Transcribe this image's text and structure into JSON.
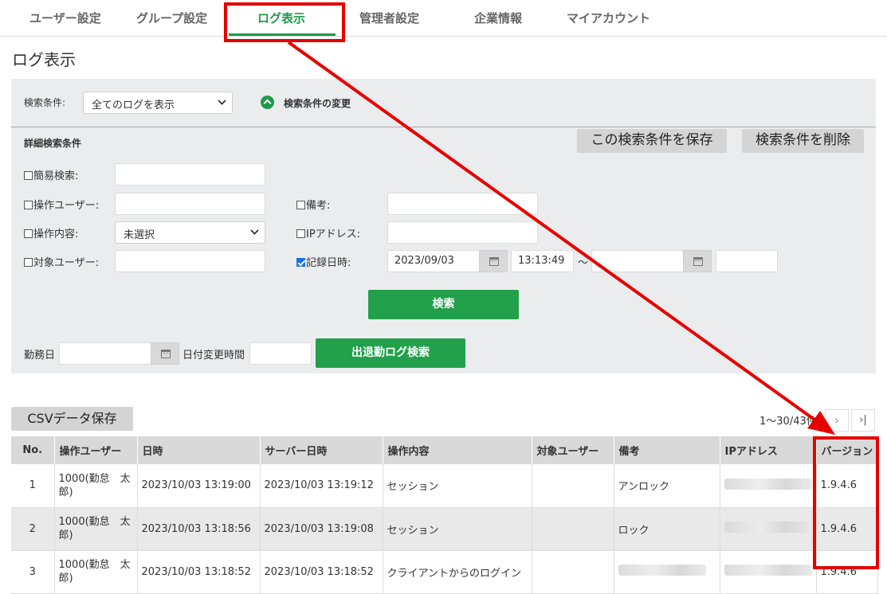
{
  "tabs": [
    {
      "label": "ユーザー設定"
    },
    {
      "label": "グループ設定"
    },
    {
      "label": "ログ表示"
    },
    {
      "label": "管理者設定"
    },
    {
      "label": "企業情報"
    },
    {
      "label": "マイアカウント"
    }
  ],
  "page_title": "ログ表示",
  "search": {
    "condition_label": "検索条件:",
    "condition_value": "全てのログを表示",
    "toggle_label": "検索条件の変更",
    "detail_title": "詳細検索条件",
    "save_button": "この検索条件を保存",
    "delete_button": "検索条件を削除",
    "simple_search_label": "簡易検索:",
    "simple_search_value": "",
    "operation_user_label": "操作ユーザー:",
    "operation_user_value": "",
    "operation_content_label": "操作内容:",
    "operation_content_value": "未選択",
    "target_user_label": "対象ユーザー:",
    "target_user_value": "",
    "note_label": "備考:",
    "note_value": "",
    "ip_label": "IPアドレス:",
    "ip_value": "",
    "recorded_label": "記録日時:",
    "recorded_date_from": "2023/09/03",
    "recorded_time_from": "13:13:49",
    "range_sep": "〜",
    "recorded_date_to": "",
    "recorded_time_to": "",
    "search_button": "検索",
    "work_day_label": "勤務日",
    "work_day_value": "",
    "date_change_label": "日付変更時間",
    "date_change_value": "",
    "attendance_button": "出退勤ログ検索"
  },
  "csv_button": "CSVデータ保存",
  "pagination": {
    "text": "1～30/43件",
    "next": "›",
    "last": "›|"
  },
  "table": {
    "headers": [
      "No.",
      "操作ユーザー",
      "日時",
      "サーバー日時",
      "操作内容",
      "対象ユーザー",
      "備考",
      "IPアドレス",
      "バージョン"
    ],
    "rows": [
      {
        "no": "1",
        "user": "1000(勤怠　太郎)",
        "datetime": "2023/10/03 13:19:00",
        "server": "2023/10/03 13:19:12",
        "op": "セッション",
        "target": "",
        "note": "アンロック",
        "version": "1.9.4.6"
      },
      {
        "no": "2",
        "user": "1000(勤怠　太郎)",
        "datetime": "2023/10/03 13:18:56",
        "server": "2023/10/03 13:19:08",
        "op": "セッション",
        "target": "",
        "note": "ロック",
        "version": "1.9.4.6"
      },
      {
        "no": "3",
        "user": "1000(勤怠　太郎)",
        "datetime": "2023/10/03 13:18:52",
        "server": "2023/10/03 13:18:52",
        "op": "クライアントからのログイン",
        "target": "",
        "note": "",
        "version": "1.9.4.6"
      }
    ]
  },
  "colors": {
    "accent": "#1e9a4c",
    "highlight": "#e60000",
    "panel": "#ebeced"
  }
}
